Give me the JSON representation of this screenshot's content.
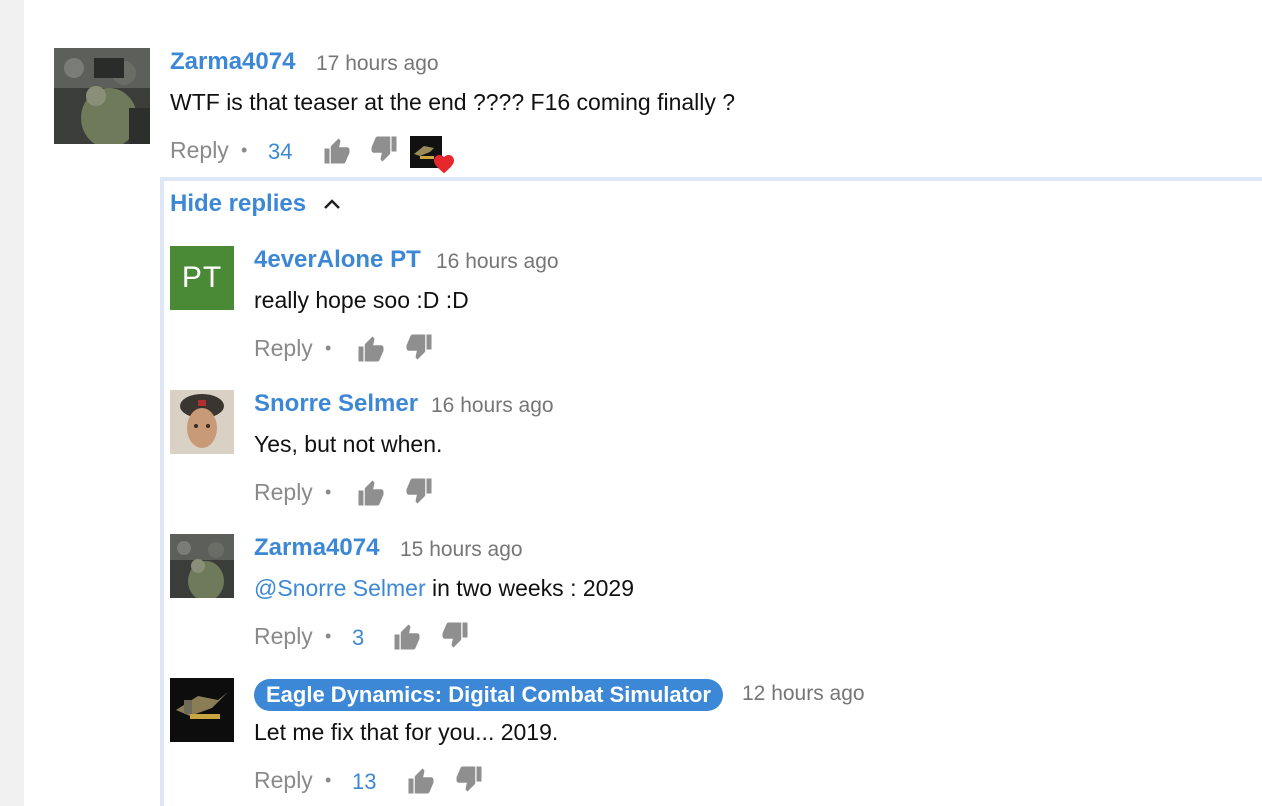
{
  "top_comment": {
    "author": "Zarma4074",
    "time": "17 hours ago",
    "text": "WTF is that teaser at the end ???? F16 coming finally ?",
    "reply_label": "Reply",
    "likes": "34",
    "creator_heart": "heart-icon"
  },
  "replies_toggle": {
    "label": "Hide replies",
    "icon": "chevron-up-icon"
  },
  "replies": [
    {
      "author": "4everAlone PT",
      "avatar_initials": "PT",
      "time": "16 hours ago",
      "text": "really hope soo :D :D",
      "reply_label": "Reply",
      "likes": ""
    },
    {
      "author": "Snorre Selmer",
      "time": "16 hours ago",
      "text": "Yes, but not when.",
      "reply_label": "Reply",
      "likes": ""
    },
    {
      "author": "Zarma4074",
      "time": "15 hours ago",
      "mention": "@Snorre Selmer",
      "text": " in two weeks : 2029",
      "reply_label": "Reply",
      "likes": "3"
    },
    {
      "author": "Eagle Dynamics: Digital Combat Simulator",
      "time": "12 hours ago",
      "text": "Let me fix that for you... 2019.",
      "reply_label": "Reply",
      "likes": "13"
    }
  ],
  "colors": {
    "link_blue": "#3d88d6",
    "grey_text": "#8a8a8a",
    "heart_red": "#e5262c",
    "thread_line": "#dde7f6"
  }
}
